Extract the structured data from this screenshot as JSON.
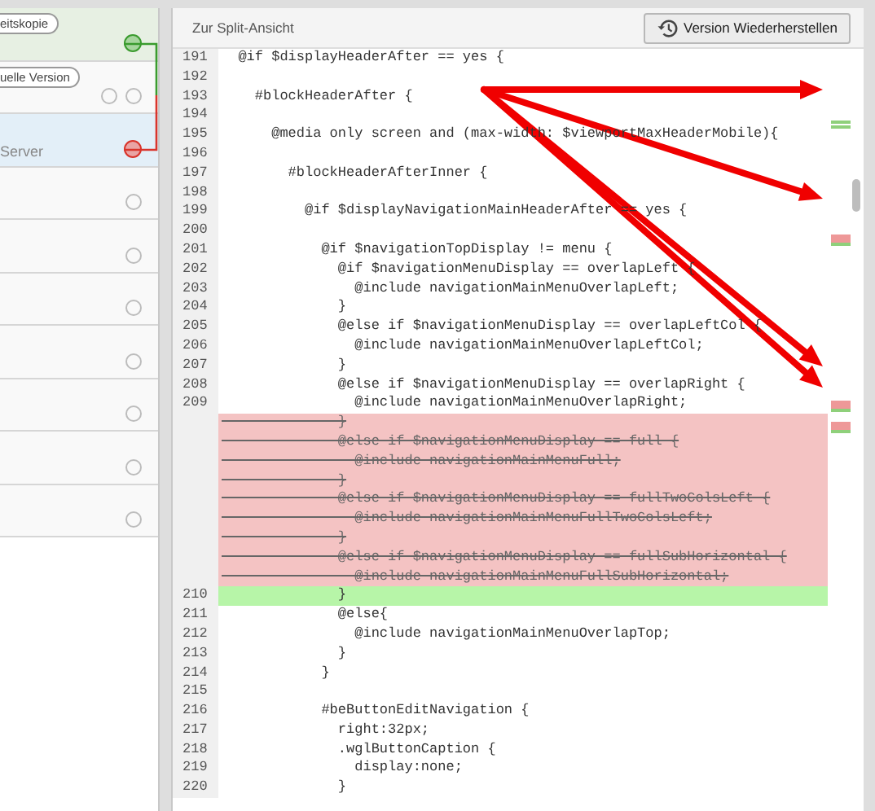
{
  "history": [
    {
      "kind": "working",
      "badge": "eitskopie",
      "markers": [
        {
          "kind": "current"
        }
      ]
    },
    {
      "kind": "plain",
      "badge": "uelle Version",
      "markers": [
        {
          "kind": "empty"
        },
        {
          "kind": "empty"
        }
      ]
    },
    {
      "kind": "server",
      "note": "Server",
      "markers": [
        {
          "kind": "compare"
        }
      ]
    },
    {
      "kind": "plain",
      "markers": [
        {
          "kind": "empty"
        }
      ]
    },
    {
      "kind": "plain",
      "markers": [
        {
          "kind": "empty"
        }
      ]
    },
    {
      "kind": "plain",
      "markers": [
        {
          "kind": "empty"
        }
      ]
    },
    {
      "kind": "plain",
      "markers": [
        {
          "kind": "empty"
        }
      ]
    },
    {
      "kind": "plain",
      "markers": [
        {
          "kind": "empty"
        }
      ]
    },
    {
      "kind": "plain",
      "markers": [
        {
          "kind": "empty"
        }
      ]
    },
    {
      "kind": "plain",
      "markers": [
        {
          "kind": "empty"
        }
      ]
    }
  ],
  "diff_header": {
    "split_view_link": "Zur Split-Ansicht",
    "restore_button": "Version Wiederherstellen"
  },
  "code_lines": [
    {
      "kind": "normal",
      "number": "191",
      "code": "  @if $displayHeaderAfter == yes {"
    },
    {
      "kind": "normal",
      "number": "192"
    },
    {
      "kind": "normal",
      "number": "193",
      "code": "    #blockHeaderAfter {"
    },
    {
      "kind": "normal",
      "number": "194"
    },
    {
      "kind": "normal",
      "number": "195",
      "code": "      @media only screen and (max-width: $viewportMaxHeaderMobile){"
    },
    {
      "kind": "normal",
      "number": "196"
    },
    {
      "kind": "normal",
      "number": "197",
      "code": "        #blockHeaderAfterInner {"
    },
    {
      "kind": "normal",
      "number": "198"
    },
    {
      "kind": "normal",
      "number": "199",
      "code": "          @if $displayNavigationMainHeaderAfter == yes {"
    },
    {
      "kind": "normal",
      "number": "200"
    },
    {
      "kind": "normal",
      "number": "201",
      "code": "            @if $navigationTopDisplay != menu {"
    },
    {
      "kind": "normal",
      "number": "202",
      "code": "              @if $navigationMenuDisplay == overlapLeft {"
    },
    {
      "kind": "normal",
      "number": "203",
      "code": "                @include navigationMainMenuOverlapLeft;"
    },
    {
      "kind": "normal",
      "number": "204",
      "code": "              }"
    },
    {
      "kind": "normal",
      "number": "205",
      "code": "              @else if $navigationMenuDisplay == overlapLeftCol {"
    },
    {
      "kind": "normal",
      "number": "206",
      "code": "                @include navigationMainMenuOverlapLeftCol;"
    },
    {
      "kind": "normal",
      "number": "207",
      "code": "              }"
    },
    {
      "kind": "normal",
      "number": "208",
      "code": "              @else if $navigationMenuDisplay == overlapRight {"
    },
    {
      "kind": "normal",
      "number": "209",
      "code": "                @include navigationMainMenuOverlapRight;"
    },
    {
      "kind": "deleted",
      "code": "              }"
    },
    {
      "kind": "deleted",
      "code": "              @else if $navigationMenuDisplay == full {"
    },
    {
      "kind": "deleted",
      "code": "                @include navigationMainMenuFull;"
    },
    {
      "kind": "deleted",
      "code": "              }"
    },
    {
      "kind": "deleted",
      "code": "              @else if $navigationMenuDisplay == fullTwoColsLeft {"
    },
    {
      "kind": "deleted",
      "code": "                @include navigationMainMenuFullTwoColsLeft;"
    },
    {
      "kind": "deleted",
      "code": "              }"
    },
    {
      "kind": "deleted",
      "code": "              @else if $navigationMenuDisplay == fullSubHorizontal {"
    },
    {
      "kind": "deleted",
      "code": "                @include navigationMainMenuFullSubHorizontal;"
    },
    {
      "kind": "added",
      "number": "210",
      "code": "              }"
    },
    {
      "kind": "normal",
      "number": "211",
      "code": "              @else{"
    },
    {
      "kind": "normal",
      "number": "212",
      "code": "                @include navigationMainMenuOverlapTop;"
    },
    {
      "kind": "normal",
      "number": "213",
      "code": "              }"
    },
    {
      "kind": "normal",
      "number": "214",
      "code": "            }"
    },
    {
      "kind": "normal",
      "number": "215"
    },
    {
      "kind": "normal",
      "number": "216",
      "code": "            #beButtonEditNavigation {"
    },
    {
      "kind": "normal",
      "number": "217",
      "code": "              right:32px;"
    },
    {
      "kind": "normal",
      "number": "218",
      "code": "              .wglButtonCaption {"
    },
    {
      "kind": "normal",
      "number": "219",
      "code": "                display:none;"
    },
    {
      "kind": "normal",
      "number": "220",
      "code": "              }"
    }
  ],
  "change_markers": [
    {
      "kind": "added"
    },
    {
      "kind": "deleted"
    },
    {
      "kind": "deleted"
    },
    {
      "kind": "deleted"
    }
  ]
}
